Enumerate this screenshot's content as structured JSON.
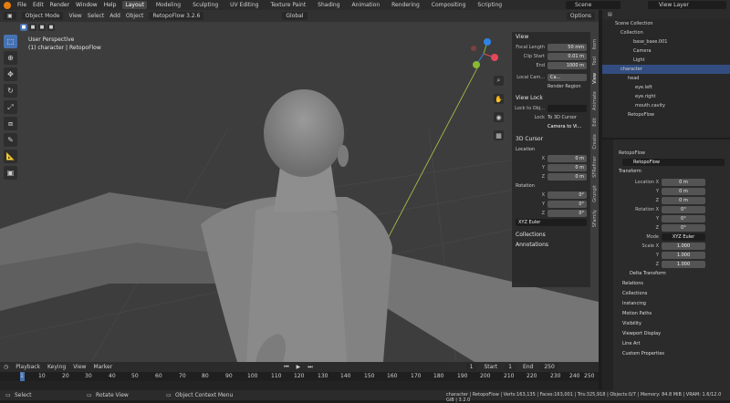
{
  "topbar": {
    "menus": [
      "File",
      "Edit",
      "Render",
      "Window",
      "Help"
    ],
    "workspaces": [
      "Layout",
      "Modeling",
      "Sculpting",
      "UV Editing",
      "Texture Paint",
      "Shading",
      "Animation",
      "Rendering",
      "Compositing",
      "Scripting"
    ],
    "active_workspace": "Layout",
    "scene": "Scene",
    "view_layer": "View Layer"
  },
  "viewport": {
    "mode": "Object Mode",
    "menus": [
      "View",
      "Select",
      "Add",
      "Object"
    ],
    "addon": "RetopoFlow 3.2.6",
    "orientation": "Global",
    "options": "Options",
    "info_line1": "User Perspective",
    "info_line2": "(1) character | RetopoFlow"
  },
  "npanel": {
    "view_header": "View",
    "focal_label": "Focal Length",
    "focal_value": "50 mm",
    "clip_label": "Clip Start",
    "clip_start": "0.01 m",
    "end_label": "End",
    "clip_end": "1000 m",
    "local_cam": "Local Cam...",
    "local_cam_val": "Ca...",
    "render_region": "Render Region",
    "view_lock": "View Lock",
    "lock_to_obj": "Lock to Obj...",
    "lock": "Lock",
    "to_3d_cursor": "To 3D Cursor",
    "camera_to_view": "Camera to Vi...",
    "cursor_header": "3D Cursor",
    "location": "Location",
    "rotation": "Rotation",
    "x": "X",
    "y": "Y",
    "z": "Z",
    "loc_x": "0 m",
    "loc_y": "0 m",
    "loc_z": "0 m",
    "rot_x": "0°",
    "rot_y": "0°",
    "rot_z": "0°",
    "rot_mode": "XYZ Euler",
    "collections": "Collections",
    "annotations": "Annotations"
  },
  "vtabs": [
    "Item",
    "Tool",
    "View",
    "Animate",
    "Edit",
    "Create",
    "SFRefiner",
    "Grungit",
    "SFamily"
  ],
  "outliner": {
    "scene_collection": "Scene Collection",
    "rows": [
      "Collection",
      "base_base.001",
      "Camera",
      "Light",
      "character",
      "head",
      "eye.left",
      "eye.right",
      "mouth.cavity",
      "RetopoFlow"
    ]
  },
  "properties": {
    "object_name": "RetopoFlow",
    "object_field": "RetopoFlow",
    "transform": "Transform",
    "loc_label": "Location X",
    "loc_x": "0 m",
    "loc_y": "0 m",
    "loc_z": "0 m",
    "rot_label": "Rotation X",
    "rot_x": "0°",
    "rot_y": "0°",
    "rot_z": "0°",
    "mode_label": "Mode",
    "mode_value": "XYZ Euler",
    "scale_label": "Scale X",
    "scale_x": "1.000",
    "scale_y": "1.000",
    "scale_z": "1.000",
    "y": "Y",
    "z": "Z",
    "sections": [
      "Delta Transform",
      "Relations",
      "Collections",
      "Instancing",
      "Motion Paths",
      "Visibility",
      "Viewport Display",
      "Line Art",
      "Custom Properties"
    ]
  },
  "timeline": {
    "menus": [
      "Playback",
      "Keying",
      "View",
      "Marker"
    ],
    "current_frame": "1",
    "start_label": "Start",
    "start": "1",
    "end_label": "End",
    "end": "250",
    "ticks": [
      "1",
      "10",
      "20",
      "30",
      "40",
      "50",
      "60",
      "70",
      "80",
      "90",
      "100",
      "110",
      "120",
      "130",
      "140",
      "150",
      "160",
      "170",
      "180",
      "190",
      "200",
      "210",
      "220",
      "230",
      "240",
      "250"
    ]
  },
  "statusbar": {
    "select": "Select",
    "rotate": "Rotate View",
    "context": "Object Context Menu",
    "stats": "character | RetopoFlow | Verts:163,135 | Faces:163,001 | Tris:325,918 | Objects:0/7 | Memory: 84.8 MiB | VRAM: 1.6/12.0 GiB | 3.2.0"
  },
  "colors": {
    "accent": "#4772b3",
    "logo": "#e87d0d"
  }
}
